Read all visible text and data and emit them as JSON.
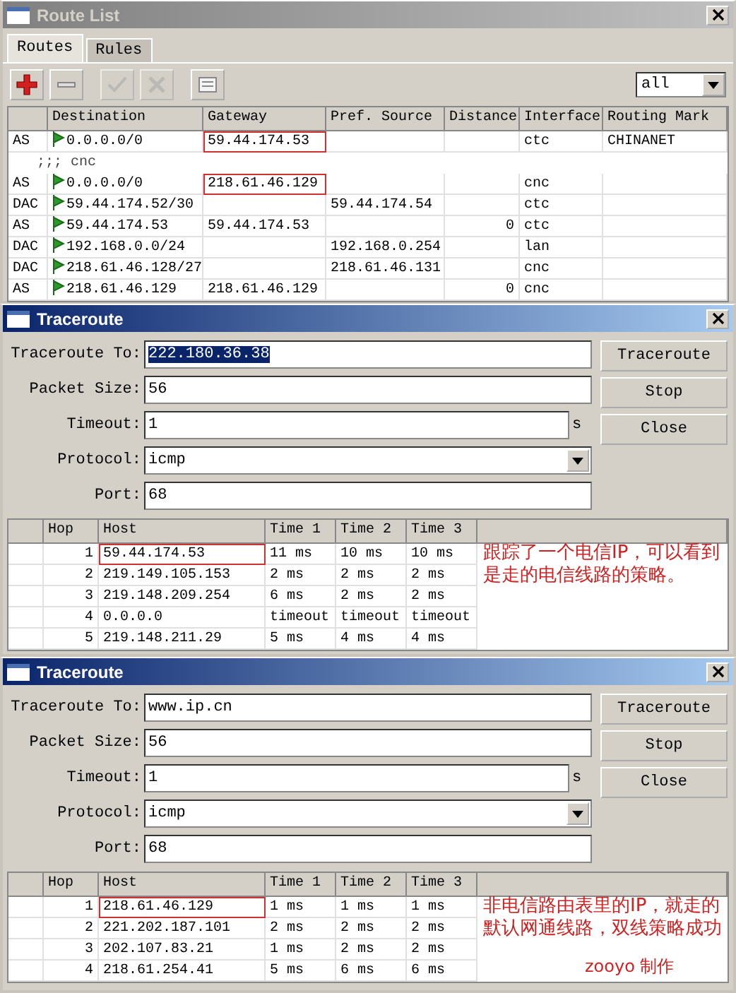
{
  "route_list": {
    "title": "Route List",
    "active": false,
    "tabs": [
      {
        "label": "Routes",
        "selected": true
      },
      {
        "label": "Rules",
        "selected": false
      }
    ],
    "toolbar": [
      {
        "kind": "add",
        "disabled": false
      },
      {
        "kind": "remove",
        "disabled": false
      },
      {
        "kind": "enable",
        "disabled": true
      },
      {
        "kind": "disable",
        "disabled": true
      },
      {
        "kind": "comment",
        "disabled": false
      }
    ],
    "filter": "all",
    "columns": [
      "",
      "Destination",
      "Gateway",
      "Pref. Source",
      "Distance",
      "Interface",
      "Routing Mark"
    ],
    "rows": [
      {
        "kind": "route",
        "flags": "AS",
        "destination": "0.0.0.0/0",
        "gateway": "59.44.174.53",
        "gateway_highlighted": true,
        "pref_source": "",
        "distance": "",
        "interface": "ctc",
        "routing_mark": "CHINANET"
      },
      {
        "kind": "comment",
        "text": ";;; cnc"
      },
      {
        "kind": "route",
        "flags": "AS",
        "destination": "0.0.0.0/0",
        "gateway": "218.61.46.129",
        "gateway_highlighted": true,
        "pref_source": "",
        "distance": "",
        "interface": "cnc",
        "routing_mark": ""
      },
      {
        "kind": "route",
        "flags": "DAC",
        "destination": "59.44.174.52/30",
        "gateway": "",
        "gateway_highlighted": false,
        "pref_source": "59.44.174.54",
        "distance": "",
        "interface": "ctc",
        "routing_mark": ""
      },
      {
        "kind": "route",
        "flags": "AS",
        "destination": "59.44.174.53",
        "gateway": "59.44.174.53",
        "gateway_highlighted": false,
        "pref_source": "",
        "distance": "0",
        "interface": "ctc",
        "routing_mark": ""
      },
      {
        "kind": "route",
        "flags": "DAC",
        "destination": "192.168.0.0/24",
        "gateway": "",
        "gateway_highlighted": false,
        "pref_source": "192.168.0.254",
        "distance": "",
        "interface": "lan",
        "routing_mark": ""
      },
      {
        "kind": "route",
        "flags": "DAC",
        "destination": "218.61.46.128/27",
        "gateway": "",
        "gateway_highlighted": false,
        "pref_source": "218.61.46.131",
        "distance": "",
        "interface": "cnc",
        "routing_mark": ""
      },
      {
        "kind": "route",
        "flags": "AS",
        "destination": "218.61.46.129",
        "gateway": "218.61.46.129",
        "gateway_highlighted": false,
        "pref_source": "",
        "distance": "0",
        "interface": "cnc",
        "routing_mark": ""
      }
    ]
  },
  "traceroutes": [
    {
      "title": "Traceroute",
      "active": true,
      "fields": [
        {
          "label": "Traceroute To:",
          "value": "222.180.36.38",
          "kind": "text",
          "text_selected": true
        },
        {
          "label": "Packet Size:",
          "value": "56",
          "kind": "text",
          "text_selected": false
        },
        {
          "label": "Timeout:",
          "value": "1",
          "kind": "unit",
          "unit": "s",
          "text_selected": false
        },
        {
          "label": "Protocol:",
          "value": "icmp",
          "kind": "select",
          "text_selected": false
        },
        {
          "label": "Port:",
          "value": "68",
          "kind": "text",
          "text_selected": false
        }
      ],
      "buttons": [
        "Traceroute",
        "Stop",
        "Close"
      ],
      "columns": [
        "",
        "Hop",
        "Host",
        "Time 1",
        "Time 2",
        "Time 3"
      ],
      "rows": [
        {
          "hop": "1",
          "host": "59.44.174.53",
          "host_highlighted": true,
          "time_1": "11 ms",
          "time_2": "10 ms",
          "time_3": "10 ms"
        },
        {
          "hop": "2",
          "host": "219.149.105.153",
          "host_highlighted": false,
          "time_1": "2 ms",
          "time_2": "2 ms",
          "time_3": "2 ms"
        },
        {
          "hop": "3",
          "host": "219.148.209.254",
          "host_highlighted": false,
          "time_1": "6 ms",
          "time_2": "2 ms",
          "time_3": "2 ms"
        },
        {
          "hop": "4",
          "host": "0.0.0.0",
          "host_highlighted": false,
          "time_1": "timeout",
          "time_2": "timeout",
          "time_3": "timeout"
        },
        {
          "hop": "5",
          "host": "219.148.211.29",
          "host_highlighted": false,
          "time_1": "5 ms",
          "time_2": "4 ms",
          "time_3": "4 ms"
        }
      ],
      "annotation": [
        "跟踪了一个电信IP，可以看到",
        "是走的电信线路的策略。"
      ]
    },
    {
      "title": "Traceroute",
      "active": true,
      "fields": [
        {
          "label": "Traceroute To:",
          "value": "www.ip.cn",
          "kind": "text",
          "text_selected": false
        },
        {
          "label": "Packet Size:",
          "value": "56",
          "kind": "text",
          "text_selected": false
        },
        {
          "label": "Timeout:",
          "value": "1",
          "kind": "unit",
          "unit": "s",
          "text_selected": false
        },
        {
          "label": "Protocol:",
          "value": "icmp",
          "kind": "select",
          "text_selected": false
        },
        {
          "label": "Port:",
          "value": "68",
          "kind": "text",
          "text_selected": false
        }
      ],
      "buttons": [
        "Traceroute",
        "Stop",
        "Close"
      ],
      "columns": [
        "",
        "Hop",
        "Host",
        "Time 1",
        "Time 2",
        "Time 3"
      ],
      "rows": [
        {
          "hop": "1",
          "host": "218.61.46.129",
          "host_highlighted": true,
          "time_1": "1 ms",
          "time_2": "1 ms",
          "time_3": "1 ms"
        },
        {
          "hop": "2",
          "host": "221.202.187.101",
          "host_highlighted": false,
          "time_1": "2 ms",
          "time_2": "2 ms",
          "time_3": "2 ms"
        },
        {
          "hop": "3",
          "host": "202.107.83.21",
          "host_highlighted": false,
          "time_1": "1 ms",
          "time_2": "2 ms",
          "time_3": "2 ms"
        },
        {
          "hop": "4",
          "host": "218.61.254.41",
          "host_highlighted": false,
          "time_1": "5 ms",
          "time_2": "6 ms",
          "time_3": "6 ms"
        }
      ],
      "annotation": [
        "非电信路由表里的IP，就走的",
        "默认网通线路，双线策略成功",
        "zooyo 制作"
      ]
    }
  ]
}
